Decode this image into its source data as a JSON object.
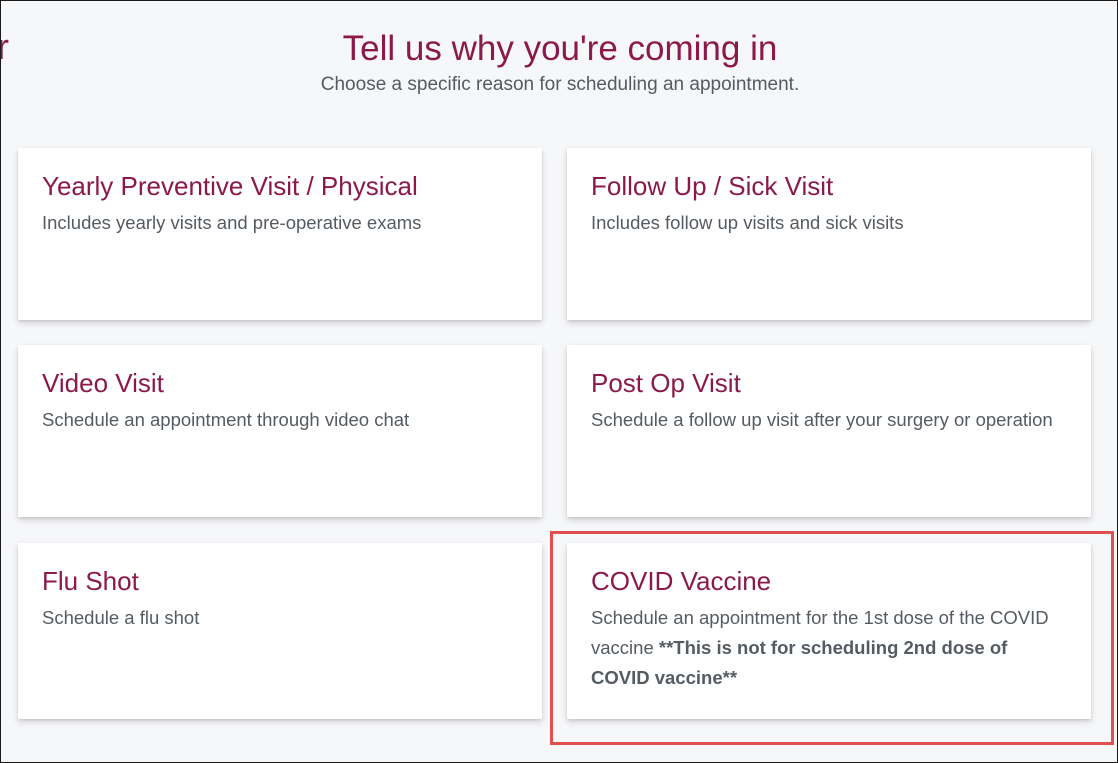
{
  "header": {
    "title": "Tell us why you're coming in",
    "subtitle": "Choose a specific reason for scheduling an appointment."
  },
  "cards": [
    {
      "title": "Yearly Preventive Visit / Physical",
      "description": "Includes yearly visits and pre-operative exams"
    },
    {
      "title": "Follow Up / Sick Visit",
      "description": "Includes follow up visits and sick visits"
    },
    {
      "title": "Video Visit",
      "description": "Schedule an appointment through video chat"
    },
    {
      "title": "Post Op Visit",
      "description": "Schedule a follow up visit after your surgery or operation"
    },
    {
      "title": "Flu Shot",
      "description": "Schedule a flu shot"
    },
    {
      "title": "COVID Vaccine",
      "description_prefix": "Schedule an appointment for the 1st dose of the COVID vaccine ",
      "description_bold": "**This is not for scheduling 2nd dose of COVID vaccine**"
    }
  ],
  "colors": {
    "brand": "#8b1a4a",
    "text_muted": "#555b62",
    "background": "#f6f7f9",
    "highlight": "#e05050"
  }
}
